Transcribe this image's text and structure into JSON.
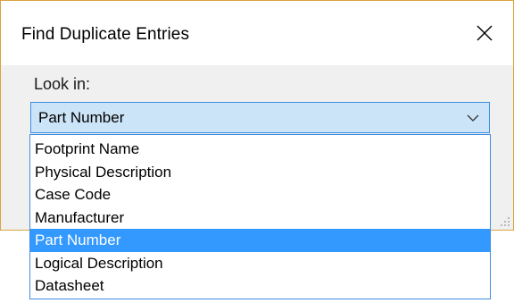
{
  "dialog": {
    "title": "Find Duplicate Entries",
    "close_icon": "close-icon",
    "border_color": "#d9a441"
  },
  "look_in": {
    "label": "Look in:",
    "selected_value": "Part Number",
    "arrow_icon": "chevron-down-icon",
    "focus_color": "#3d8ee0",
    "focus_fill": "#cce4f7"
  },
  "dropdown": {
    "options": [
      {
        "label": "Footprint Name",
        "selected": false
      },
      {
        "label": "Physical Description",
        "selected": false
      },
      {
        "label": "Case Code",
        "selected": false
      },
      {
        "label": "Manufacturer",
        "selected": false
      },
      {
        "label": "Part Number",
        "selected": true
      },
      {
        "label": "Logical Description",
        "selected": false
      },
      {
        "label": "Datasheet",
        "selected": false
      }
    ],
    "highlight_color": "#3399ff"
  }
}
